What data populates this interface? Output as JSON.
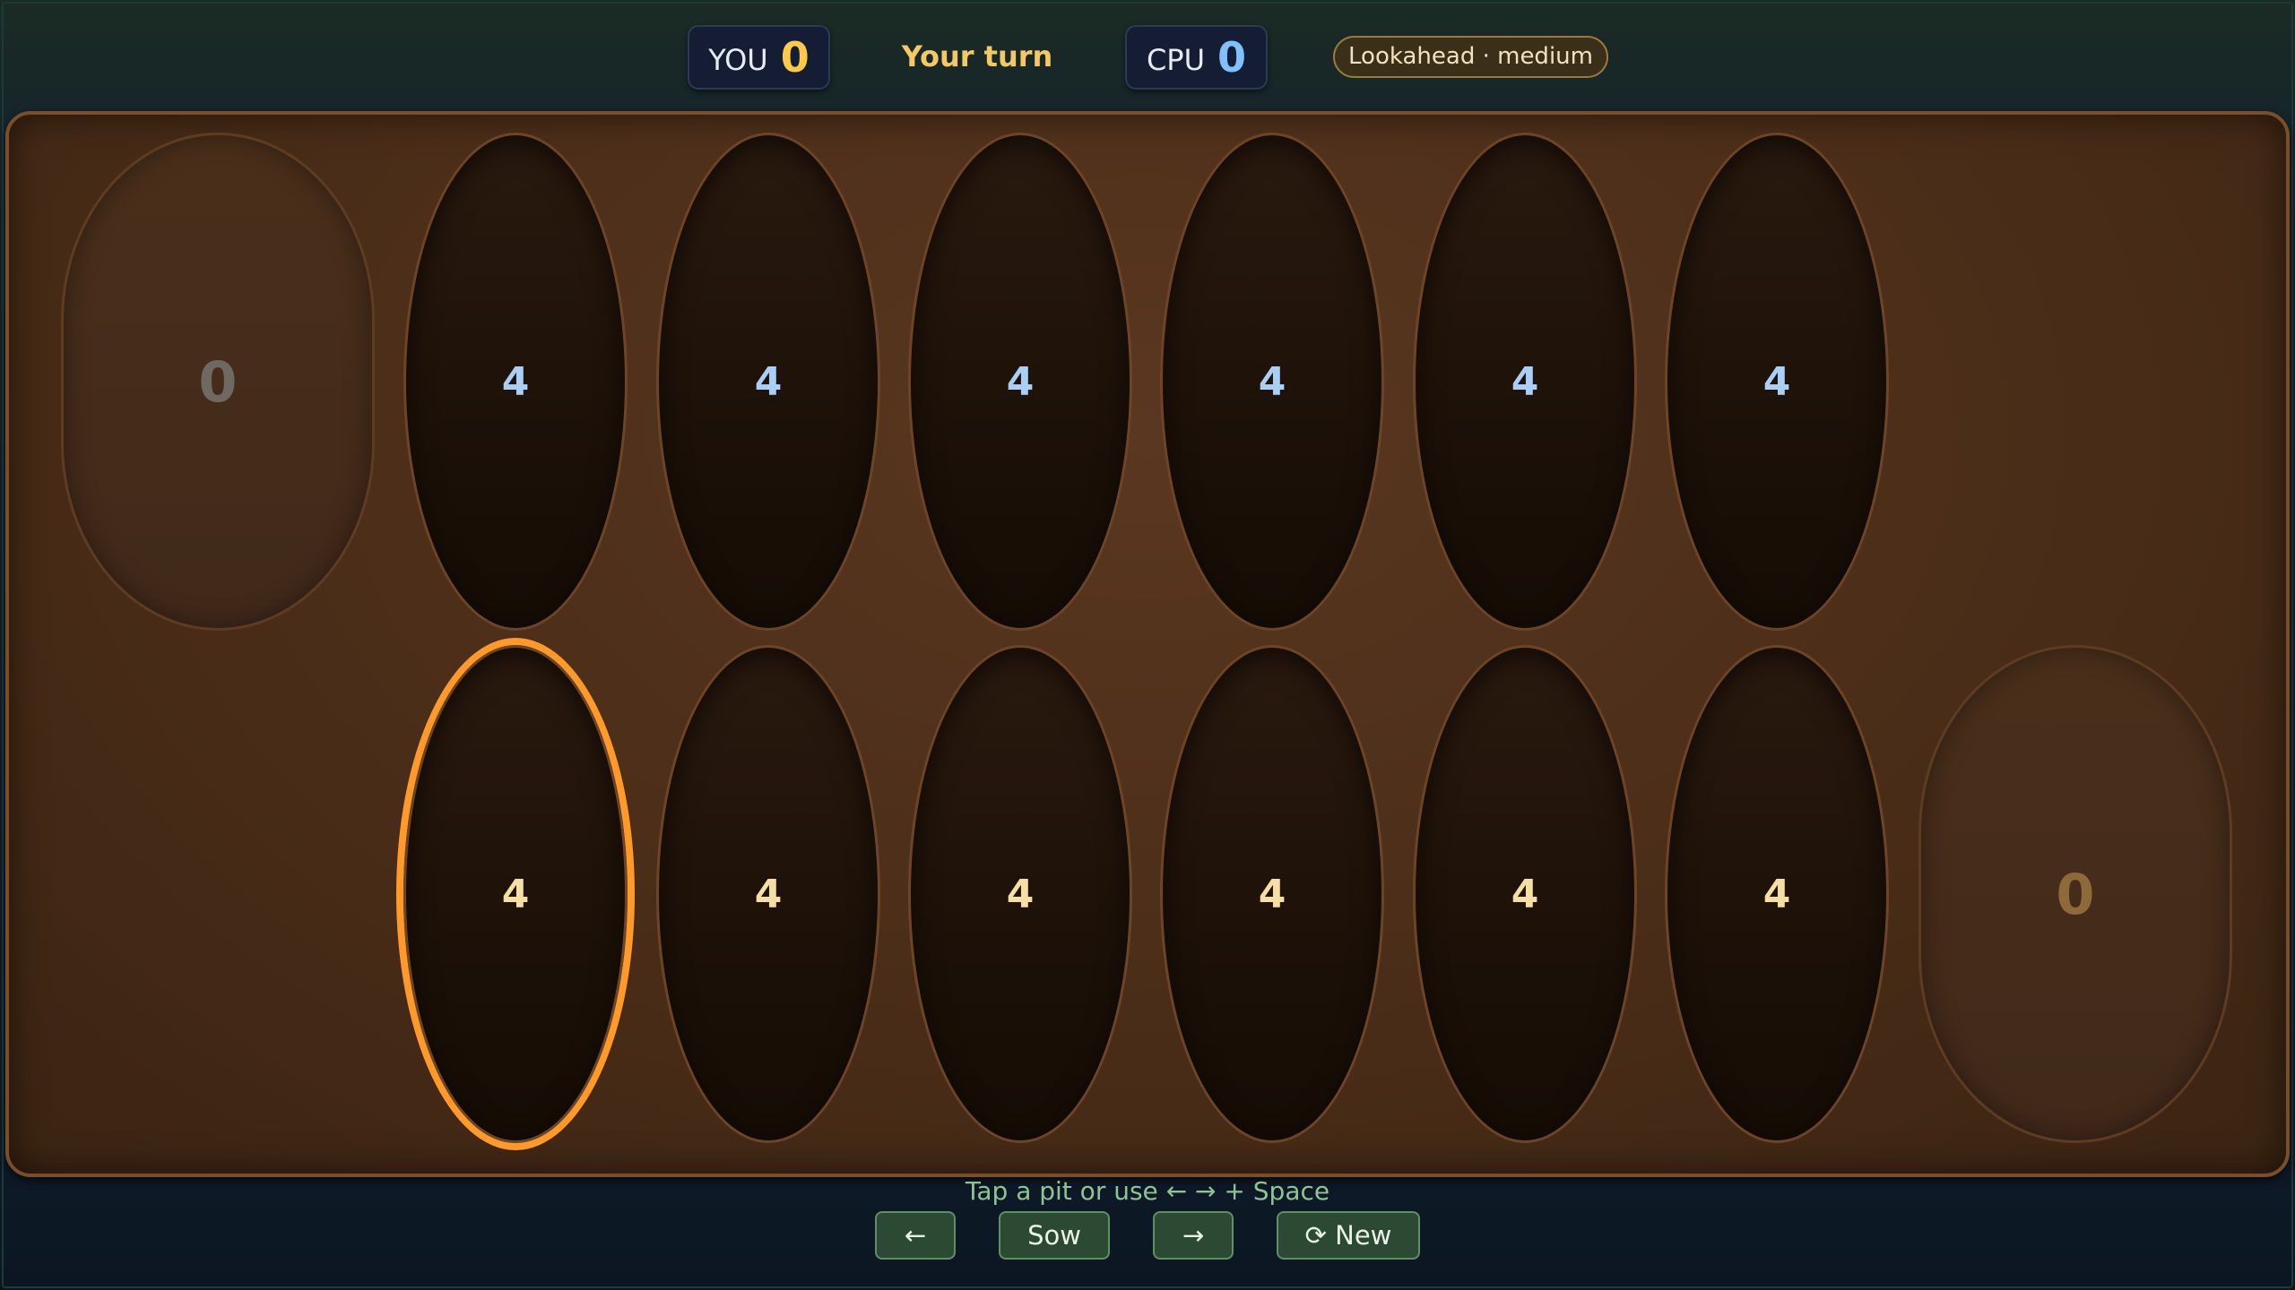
{
  "header": {
    "you_label": "YOU",
    "you_score": "0",
    "you_color": "#ffc94a",
    "cpu_label": "CPU",
    "cpu_score": "0",
    "cpu_color": "#7fc1ff",
    "turn_text": "Your turn",
    "ai_badge": "Lookahead · medium"
  },
  "board": {
    "cpu_store": "0",
    "you_store": "0",
    "cpu_pits": [
      "4",
      "4",
      "4",
      "4",
      "4",
      "4"
    ],
    "you_pits": [
      "4",
      "4",
      "4",
      "4",
      "4",
      "4"
    ],
    "selected_pit": "you-pit-1",
    "selection_color": "#ff9a2a"
  },
  "footer": {
    "hint": "Tap a pit or use ← → + Space",
    "left_label": "←",
    "sow_label": "Sow",
    "right_label": "→",
    "new_label": "⟳ New"
  }
}
